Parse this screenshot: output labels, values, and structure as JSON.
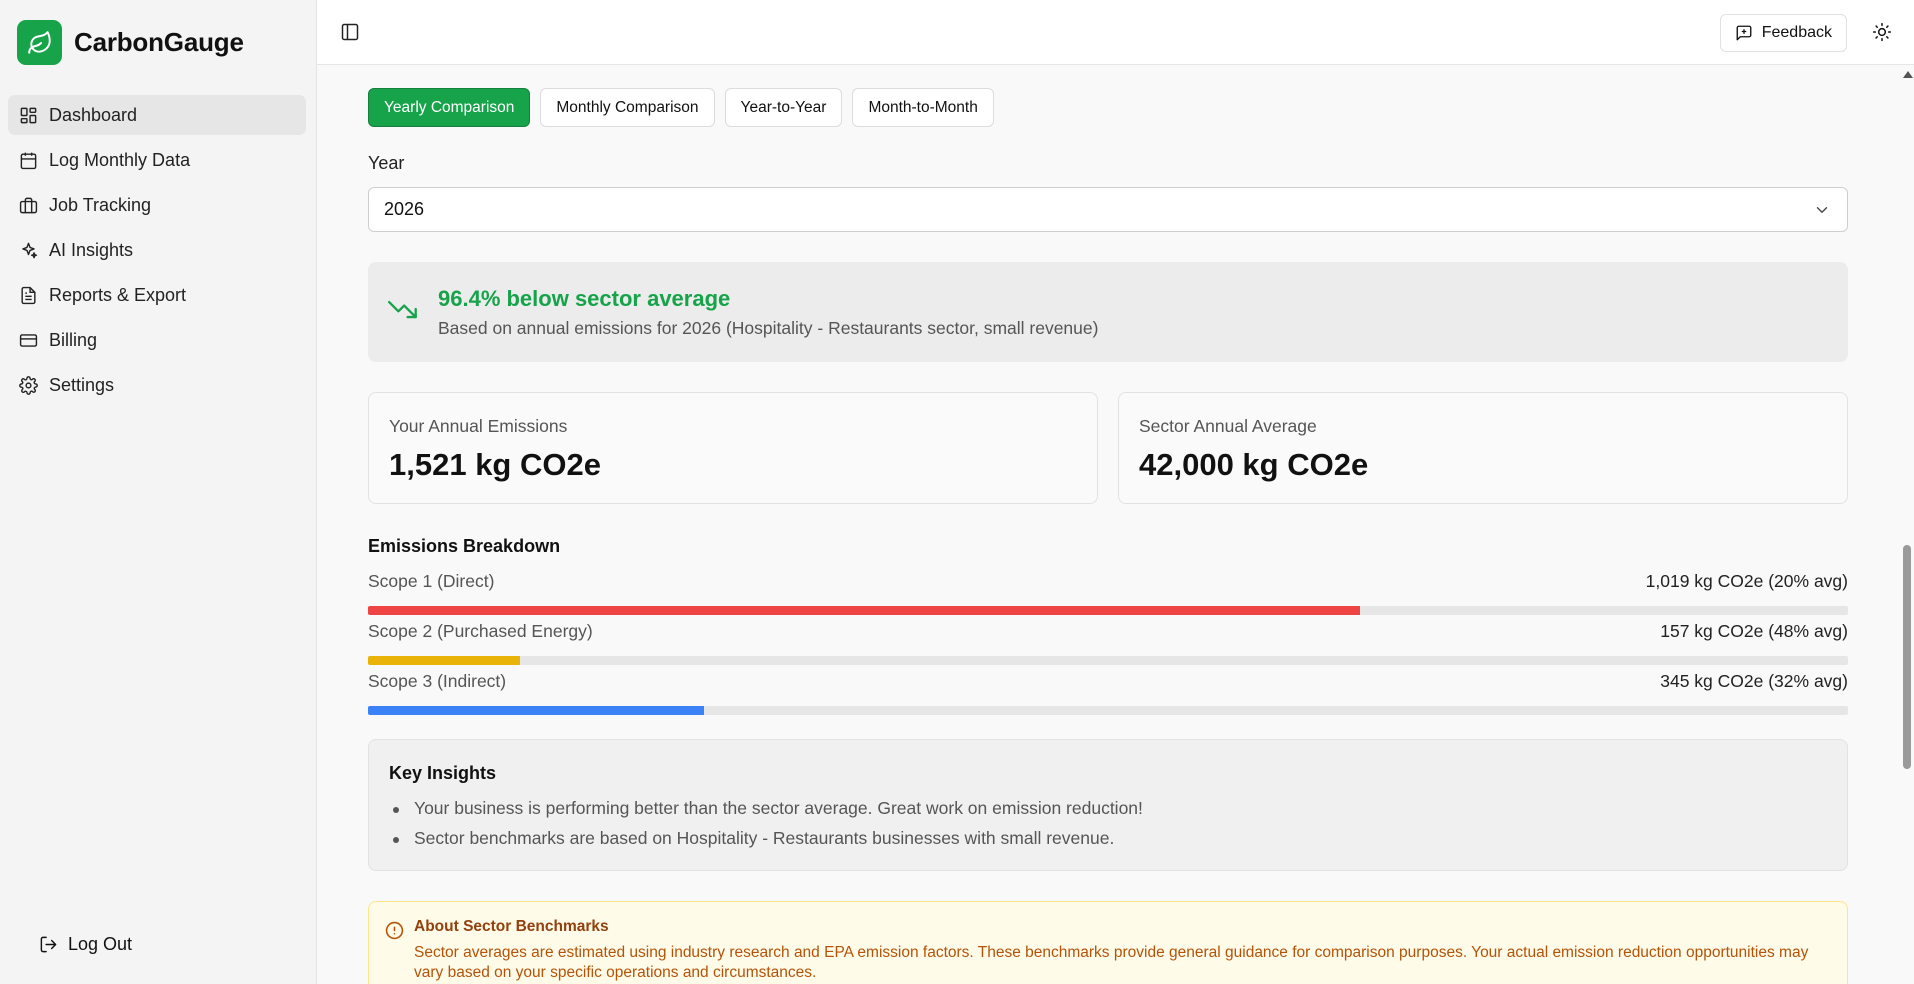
{
  "app": {
    "name": "CarbonGauge",
    "brand_color": "#16a34a"
  },
  "sidebar": {
    "items": [
      {
        "label": "Dashboard",
        "icon": "dashboard-icon",
        "active": true
      },
      {
        "label": "Log Monthly Data",
        "icon": "calendar-icon"
      },
      {
        "label": "Job Tracking",
        "icon": "briefcase-icon"
      },
      {
        "label": "AI Insights",
        "icon": "sparkles-icon"
      },
      {
        "label": "Reports & Export",
        "icon": "file-text-icon"
      },
      {
        "label": "Billing",
        "icon": "credit-card-icon"
      },
      {
        "label": "Settings",
        "icon": "gear-icon"
      }
    ],
    "logout_label": "Log Out"
  },
  "header": {
    "feedback_label": "Feedback"
  },
  "tabs": [
    {
      "label": "Yearly Comparison",
      "active": true
    },
    {
      "label": "Monthly Comparison"
    },
    {
      "label": "Year-to-Year"
    },
    {
      "label": "Month-to-Month"
    }
  ],
  "year": {
    "label": "Year",
    "value": "2026"
  },
  "banner": {
    "title": "96.4% below sector average",
    "subtitle": "Based on annual emissions for 2026 (Hospitality - Restaurants sector, small revenue)"
  },
  "cards": {
    "yours": {
      "label": "Your Annual Emissions",
      "value": "1,521 kg CO2e"
    },
    "sector": {
      "label": "Sector Annual Average",
      "value": "42,000 kg CO2e"
    }
  },
  "breakdown": {
    "title": "Emissions Breakdown",
    "scopes": [
      {
        "name": "Scope 1 (Direct)",
        "value": "1,019 kg CO2e (20% avg)",
        "fraction": 0.67,
        "color": "#ef4444"
      },
      {
        "name": "Scope 2 (Purchased Energy)",
        "value": "157 kg CO2e (48% avg)",
        "fraction": 0.103,
        "color": "#eab308"
      },
      {
        "name": "Scope 3 (Indirect)",
        "value": "345 kg CO2e (32% avg)",
        "fraction": 0.227,
        "color": "#3b82f6"
      }
    ]
  },
  "insights": {
    "title": "Key Insights",
    "items": [
      "Your business is performing better than the sector average. Great work on emission reduction!",
      "Sector benchmarks are based on Hospitality - Restaurants businesses with small revenue."
    ]
  },
  "notice": {
    "title": "About Sector Benchmarks",
    "text": "Sector averages are estimated using industry research and EPA emission factors. These benchmarks provide general guidance for comparison purposes. Your actual emission reduction opportunities may vary based on your specific operations and circumstances."
  }
}
